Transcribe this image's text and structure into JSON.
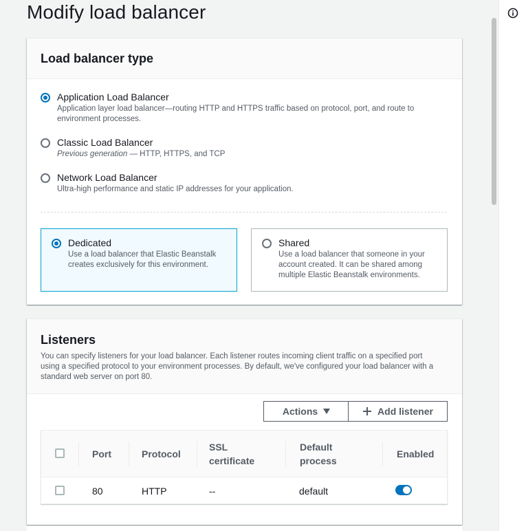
{
  "page": {
    "title": "Modify load balancer"
  },
  "load_balancer_type": {
    "title": "Load balancer type",
    "options": [
      {
        "label": "Application Load Balancer",
        "desc": "Application layer load balancer—routing HTTP and HTTPS traffic based on protocol, port, and route to environment processes.",
        "selected": true
      },
      {
        "label": "Classic Load Balancer",
        "desc_italic": "Previous generation",
        "desc_rest": " — HTTP, HTTPS, and TCP",
        "selected": false
      },
      {
        "label": "Network Load Balancer",
        "desc": "Ultra-high performance and static IP addresses for your application.",
        "selected": false
      }
    ],
    "tiles": [
      {
        "label": "Dedicated",
        "desc": "Use a load balancer that Elastic Beanstalk creates exclusively for this environment.",
        "selected": true
      },
      {
        "label": "Shared",
        "desc": "Use a load balancer that someone in your account created. It can be shared among multiple Elastic Beanstalk environments.",
        "selected": false
      }
    ]
  },
  "listeners": {
    "title": "Listeners",
    "desc": "You can specify listeners for your load balancer. Each listener routes incoming client traffic on a specified port using a specified protocol to your environment processes. By default, we've configured your load balancer with a standard web server on port 80.",
    "actions_label": "Actions",
    "add_label": "Add listener",
    "columns": [
      "Port",
      "Protocol",
      "SSL certificate",
      "Default process",
      "Enabled"
    ],
    "rows": [
      {
        "port": "80",
        "protocol": "HTTP",
        "ssl": "--",
        "process": "default",
        "enabled": true
      }
    ]
  },
  "icons": {
    "info": "info-icon",
    "caret": "caret-down-icon",
    "add": "plus-icon"
  },
  "colors": {
    "accent": "#0073bb",
    "selected_tile_bg": "#f1faff",
    "selected_tile_border": "#00a1c9"
  }
}
